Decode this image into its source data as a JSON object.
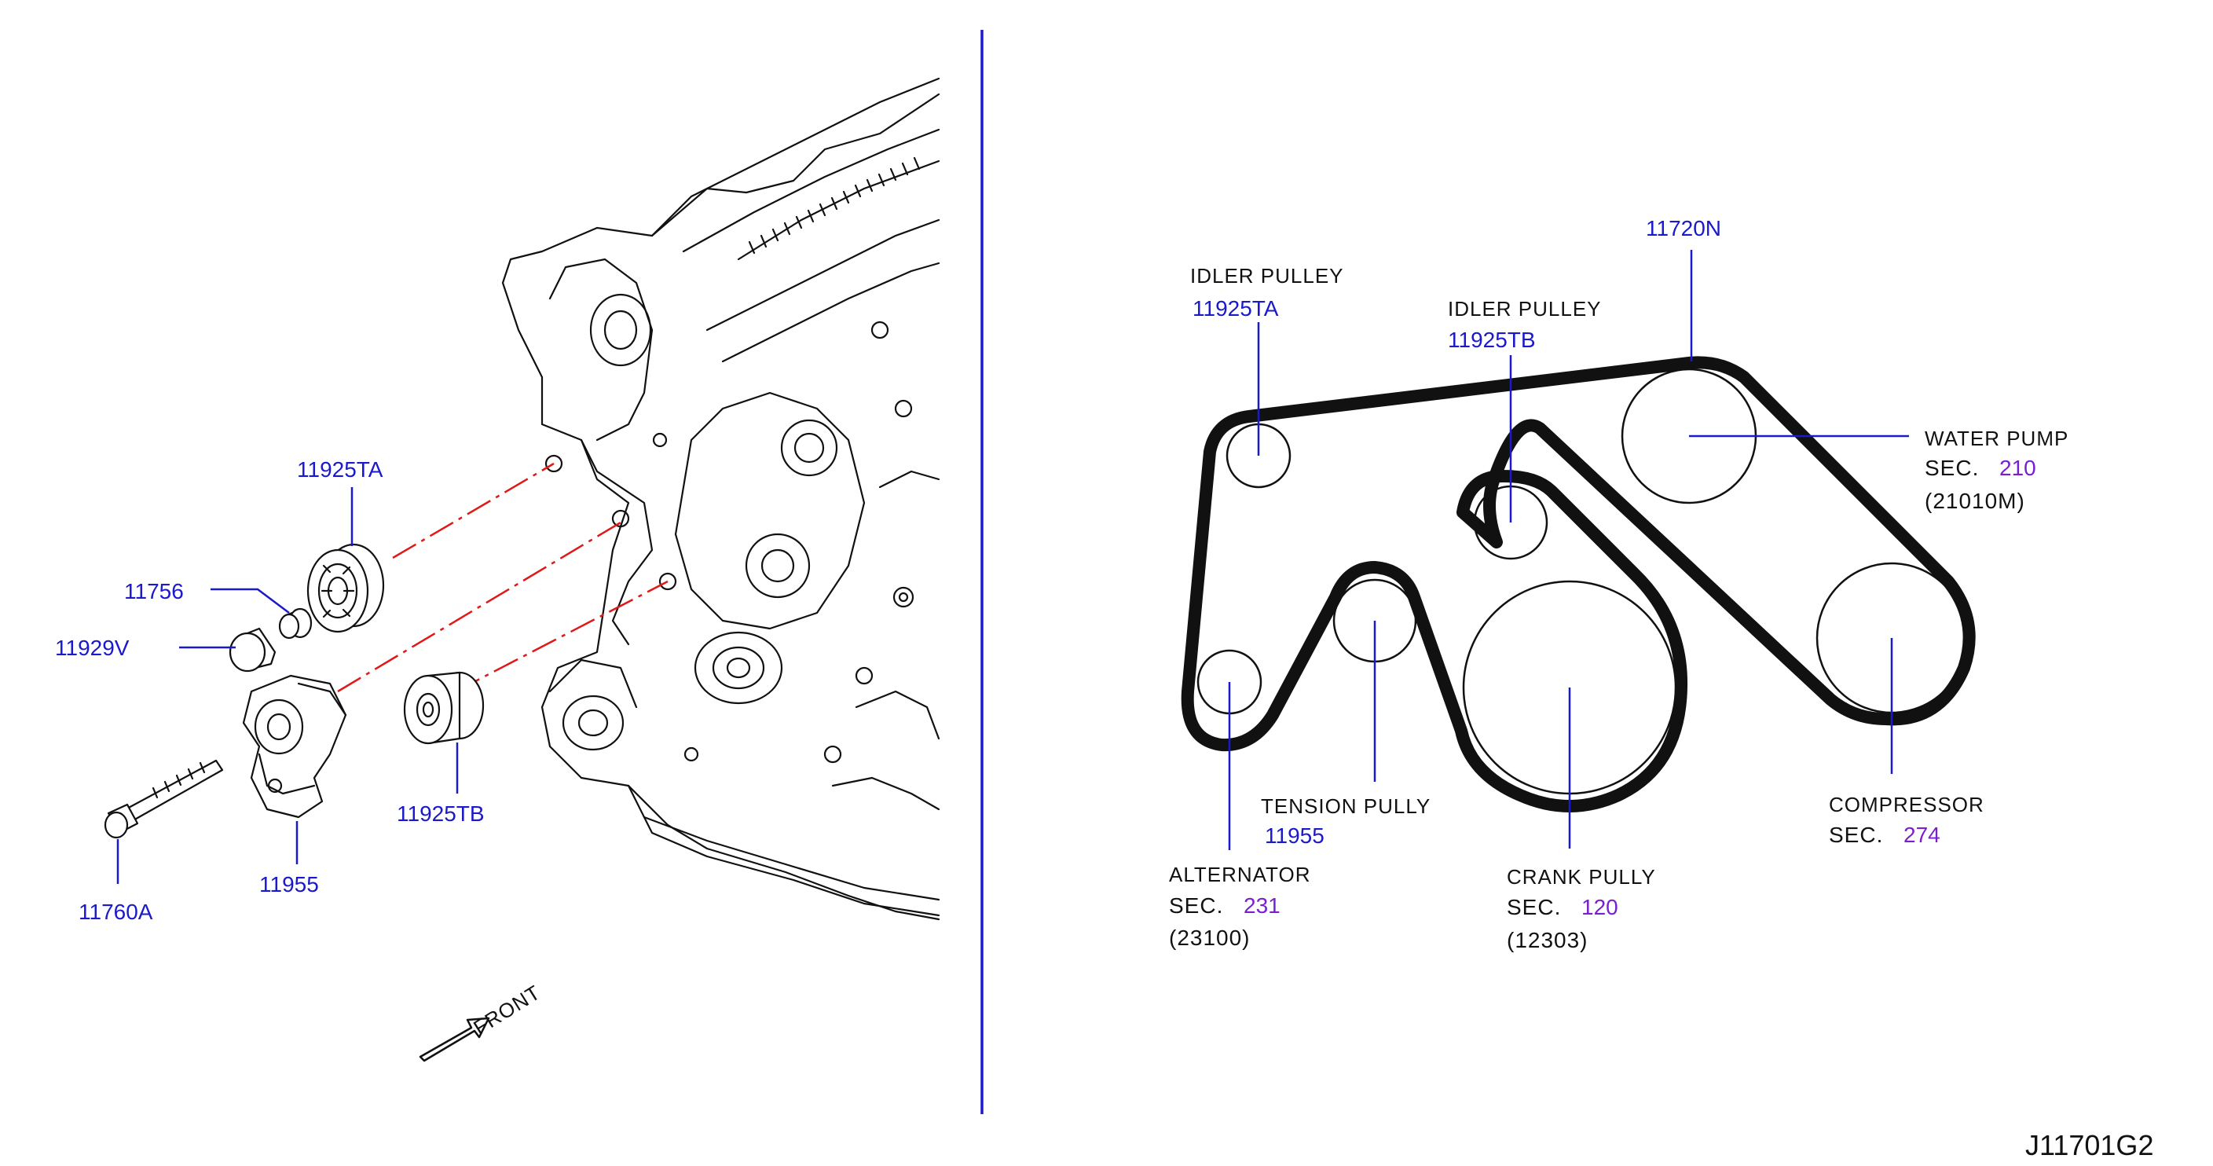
{
  "diagram_code": "J11701G2",
  "front_label": "FRONT",
  "left_parts": {
    "idler_ta": "11925TA",
    "collar": "11756",
    "cap": "11929V",
    "tensioner": "11955",
    "bolt": "11760A",
    "idler_tb": "11925TB"
  },
  "belt_diagram": {
    "belt_part": "11720N",
    "idler_ta": {
      "name": "IDLER  PULLEY",
      "part": "11925TA"
    },
    "idler_tb": {
      "name": "IDLER  PULLEY",
      "part": "11925TB"
    },
    "water_pump": {
      "name": "WATER  PUMP",
      "sec_label": "SEC.",
      "sec": "210",
      "code": "(21010M)"
    },
    "tension": {
      "name": "TENSION  PULLY",
      "part": "11955"
    },
    "alternator": {
      "name": "ALTERNATOR",
      "sec_label": "SEC.",
      "sec": "231",
      "code": "(23100)"
    },
    "crank": {
      "name": "CRANK  PULLY",
      "sec_label": "SEC.",
      "sec": "120",
      "code": "(12303)"
    },
    "compressor": {
      "name": "COMPRESSOR",
      "sec_label": "SEC.",
      "sec": "274"
    }
  },
  "colors": {
    "part_number": "#1a1acc",
    "section": "#7a1fd0",
    "divider": "#1a1acc",
    "centerline": "#e01818"
  }
}
